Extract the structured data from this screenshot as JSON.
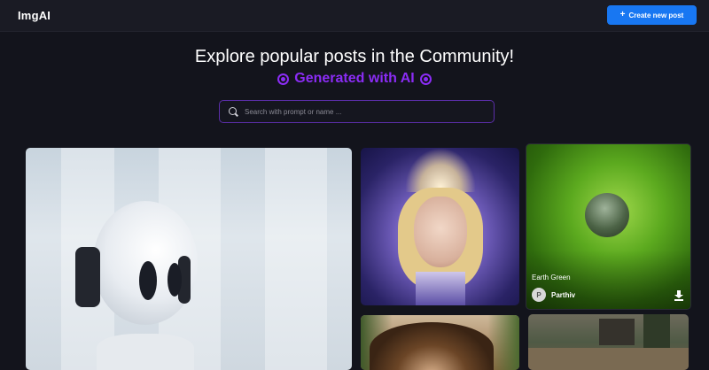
{
  "header": {
    "logo": "ImgAI",
    "create_button": "Create new post"
  },
  "hero": {
    "title": "Explore popular posts in the Community!",
    "subtitle": "Generated with AI"
  },
  "search": {
    "placeholder": "Search with prompt or name ..."
  },
  "posts": [
    {
      "id": "robot",
      "title": "",
      "author": ""
    },
    {
      "id": "woman",
      "title": "",
      "author": ""
    },
    {
      "id": "leaf",
      "title": "Earth Green",
      "author": "Parthiv",
      "avatar_letter": "P"
    },
    {
      "id": "man",
      "title": "",
      "author": ""
    },
    {
      "id": "ruins",
      "title": "",
      "author": ""
    }
  ],
  "colors": {
    "accent": "#8b2cf5",
    "primary_button": "#1877f2",
    "background": "#13141c"
  }
}
